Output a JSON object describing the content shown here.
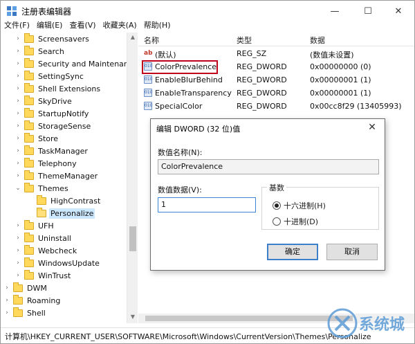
{
  "window": {
    "title": "注册表编辑器",
    "min_glyph": "—",
    "max_glyph": "☐",
    "close_glyph": "✕"
  },
  "menu": [
    "文件(F)",
    "编辑(E)",
    "查看(V)",
    "收藏夹(A)",
    "帮助(H)"
  ],
  "tree": [
    {
      "label": "Screensavers",
      "expander": "›",
      "level": 2
    },
    {
      "label": "Search",
      "expander": "›",
      "level": 2
    },
    {
      "label": "Security and Maintenance",
      "expander": "›",
      "level": 2
    },
    {
      "label": "SettingSync",
      "expander": "›",
      "level": 2
    },
    {
      "label": "Shell Extensions",
      "expander": "›",
      "level": 2
    },
    {
      "label": "SkyDrive",
      "expander": "›",
      "level": 2
    },
    {
      "label": "StartupNotify",
      "expander": "›",
      "level": 2
    },
    {
      "label": "StorageSense",
      "expander": "›",
      "level": 2
    },
    {
      "label": "Store",
      "expander": "›",
      "level": 2
    },
    {
      "label": "TaskManager",
      "expander": "›",
      "level": 2
    },
    {
      "label": "Telephony",
      "expander": "›",
      "level": 2
    },
    {
      "label": "ThemeManager",
      "expander": "›",
      "level": 2
    },
    {
      "label": "Themes",
      "expander": "⌄",
      "level": 2
    },
    {
      "label": "HighContrast",
      "expander": "",
      "level": 3
    },
    {
      "label": "Personalize",
      "expander": "",
      "level": 3,
      "selected": true
    },
    {
      "label": "UFH",
      "expander": "›",
      "level": 2
    },
    {
      "label": "Uninstall",
      "expander": "›",
      "level": 2
    },
    {
      "label": "Webcheck",
      "expander": "›",
      "level": 2
    },
    {
      "label": "WindowsUpdate",
      "expander": "›",
      "level": 2
    },
    {
      "label": "WinTrust",
      "expander": "›",
      "level": 2
    },
    {
      "label": "DWM",
      "expander": "›",
      "level": 1
    },
    {
      "label": "Roaming",
      "expander": "›",
      "level": 1
    },
    {
      "label": "Shell",
      "expander": "›",
      "level": 1
    }
  ],
  "list": {
    "headers": {
      "name": "名称",
      "type": "类型",
      "data": "数据"
    },
    "rows": [
      {
        "icon": "ab",
        "name": "(默认)",
        "type": "REG_SZ",
        "data": "(数值未设置)"
      },
      {
        "icon": "bin",
        "name": "ColorPrevalence",
        "type": "REG_DWORD",
        "data": "0x00000000 (0)",
        "highlighted": true
      },
      {
        "icon": "bin",
        "name": "EnableBlurBehind",
        "type": "REG_DWORD",
        "data": "0x00000001 (1)"
      },
      {
        "icon": "bin",
        "name": "EnableTransparency",
        "type": "REG_DWORD",
        "data": "0x00000001 (1)"
      },
      {
        "icon": "bin",
        "name": "SpecialColor",
        "type": "REG_DWORD",
        "data": "0x00cc8f29 (13405993)"
      }
    ]
  },
  "dialog": {
    "title": "编辑 DWORD (32 位)值",
    "close_glyph": "✕",
    "name_label": "数值名称(N):",
    "name_value": "ColorPrevalence",
    "data_label": "数值数据(V):",
    "data_value": "1",
    "base_label": "基数",
    "hex_label": "十六进制(H)",
    "dec_label": "十进制(D)",
    "ok_label": "确定",
    "cancel_label": "取消"
  },
  "status": {
    "path": "计算机\\HKEY_CURRENT_USER\\SOFTWARE\\Microsoft\\Windows\\CurrentVersion\\Themes\\Personalize"
  },
  "watermark": {
    "text": "系统城"
  },
  "colors": {
    "highlight_border": "#c0001a",
    "selection": "#cce8ff",
    "folder": "#ffd85c",
    "accent": "#3c7fc9"
  }
}
